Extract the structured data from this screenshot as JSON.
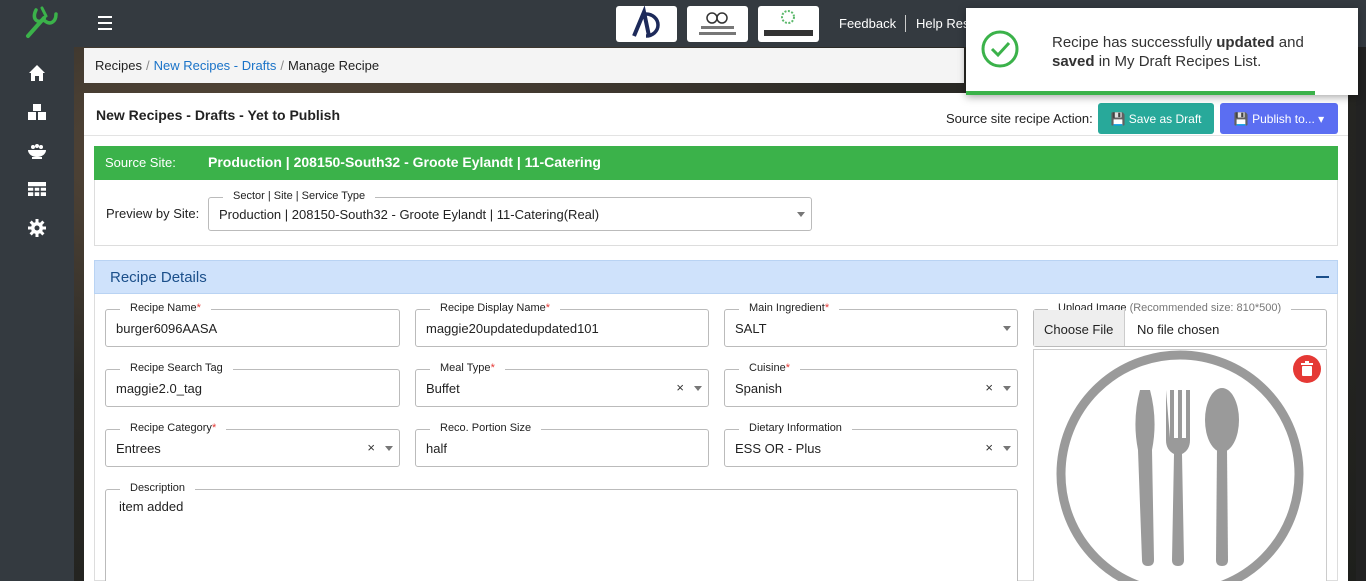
{
  "topbar": {
    "partners": [
      "AD logo",
      "voice of customer",
      "Leanpath"
    ],
    "links": {
      "feedback": "Feedback",
      "help": "Help Res"
    }
  },
  "sidebar": {
    "icons": [
      "home-icon",
      "boxes-icon",
      "dish-icon",
      "table-icon",
      "gear-icon"
    ]
  },
  "breadcrumb": {
    "items": [
      "Recipes",
      "New Recipes - Drafts",
      "Manage Recipe"
    ]
  },
  "card": {
    "title": "New Recipes - Drafts - Yet to Publish",
    "action_label": "Source site recipe Action:",
    "save_draft": "Save as Draft",
    "publish": "Publish to..."
  },
  "source": {
    "label": "Source Site:",
    "value": "Production | 208150-South32 - Groote Eylandt | 11-Catering"
  },
  "preview": {
    "label": "Preview by Site:",
    "legend": "Sector | Site | Service Type",
    "value": "Production | 208150-South32 - Groote Eylandt | 11-Catering(Real)"
  },
  "details": {
    "title": "Recipe Details",
    "fields": {
      "recipe_name": {
        "label": "Recipe Name",
        "value": "burger6096AASA"
      },
      "display_name": {
        "label": "Recipe Display Name",
        "value": "maggie20updatedupdated101"
      },
      "main_ingredient": {
        "label": "Main Ingredient",
        "value": "SALT"
      },
      "search_tag": {
        "label": "Recipe Search Tag",
        "value": "maggie2.0_tag"
      },
      "meal_type": {
        "label": "Meal Type",
        "value": "Buffet"
      },
      "cuisine": {
        "label": "Cuisine",
        "value": "Spanish"
      },
      "category": {
        "label": "Recipe Category",
        "value": "Entrees"
      },
      "portion": {
        "label": "Reco. Portion Size",
        "value": "half"
      },
      "dietary": {
        "label": "Dietary Information",
        "value": "ESS OR - Plus"
      },
      "description": {
        "label": "Description",
        "value": "item added"
      }
    },
    "upload": {
      "label": "Upload Image",
      "hint": "(Recommended size: 810*500)",
      "choose": "Choose File",
      "none": "No file chosen"
    },
    "required_mark": "*",
    "clear_mark": "×"
  },
  "toast": {
    "part1": "Recipe has successfully ",
    "bold1": "updated",
    "part2": " and ",
    "bold2": "saved",
    "part3": " in My Draft Recipes List.",
    "progress": 0.89
  }
}
